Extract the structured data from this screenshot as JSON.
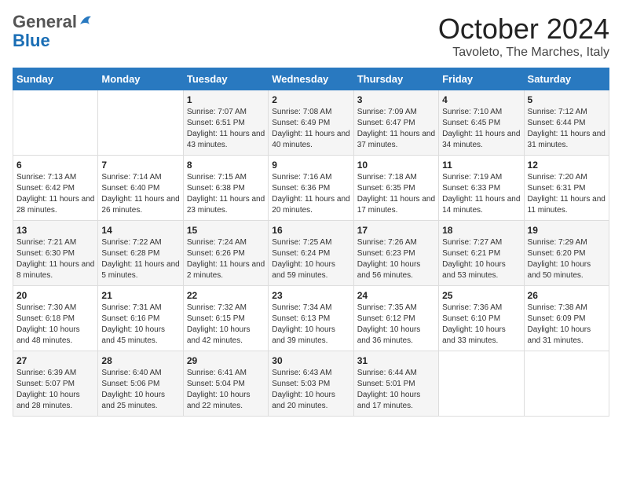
{
  "header": {
    "logo_general": "General",
    "logo_blue": "Blue",
    "month": "October 2024",
    "location": "Tavoleto, The Marches, Italy"
  },
  "days_of_week": [
    "Sunday",
    "Monday",
    "Tuesday",
    "Wednesday",
    "Thursday",
    "Friday",
    "Saturday"
  ],
  "weeks": [
    [
      {
        "day": null
      },
      {
        "day": null
      },
      {
        "day": "1",
        "sunrise": "Sunrise: 7:07 AM",
        "sunset": "Sunset: 6:51 PM",
        "daylight": "Daylight: 11 hours and 43 minutes."
      },
      {
        "day": "2",
        "sunrise": "Sunrise: 7:08 AM",
        "sunset": "Sunset: 6:49 PM",
        "daylight": "Daylight: 11 hours and 40 minutes."
      },
      {
        "day": "3",
        "sunrise": "Sunrise: 7:09 AM",
        "sunset": "Sunset: 6:47 PM",
        "daylight": "Daylight: 11 hours and 37 minutes."
      },
      {
        "day": "4",
        "sunrise": "Sunrise: 7:10 AM",
        "sunset": "Sunset: 6:45 PM",
        "daylight": "Daylight: 11 hours and 34 minutes."
      },
      {
        "day": "5",
        "sunrise": "Sunrise: 7:12 AM",
        "sunset": "Sunset: 6:44 PM",
        "daylight": "Daylight: 11 hours and 31 minutes."
      }
    ],
    [
      {
        "day": "6",
        "sunrise": "Sunrise: 7:13 AM",
        "sunset": "Sunset: 6:42 PM",
        "daylight": "Daylight: 11 hours and 28 minutes."
      },
      {
        "day": "7",
        "sunrise": "Sunrise: 7:14 AM",
        "sunset": "Sunset: 6:40 PM",
        "daylight": "Daylight: 11 hours and 26 minutes."
      },
      {
        "day": "8",
        "sunrise": "Sunrise: 7:15 AM",
        "sunset": "Sunset: 6:38 PM",
        "daylight": "Daylight: 11 hours and 23 minutes."
      },
      {
        "day": "9",
        "sunrise": "Sunrise: 7:16 AM",
        "sunset": "Sunset: 6:36 PM",
        "daylight": "Daylight: 11 hours and 20 minutes."
      },
      {
        "day": "10",
        "sunrise": "Sunrise: 7:18 AM",
        "sunset": "Sunset: 6:35 PM",
        "daylight": "Daylight: 11 hours and 17 minutes."
      },
      {
        "day": "11",
        "sunrise": "Sunrise: 7:19 AM",
        "sunset": "Sunset: 6:33 PM",
        "daylight": "Daylight: 11 hours and 14 minutes."
      },
      {
        "day": "12",
        "sunrise": "Sunrise: 7:20 AM",
        "sunset": "Sunset: 6:31 PM",
        "daylight": "Daylight: 11 hours and 11 minutes."
      }
    ],
    [
      {
        "day": "13",
        "sunrise": "Sunrise: 7:21 AM",
        "sunset": "Sunset: 6:30 PM",
        "daylight": "Daylight: 11 hours and 8 minutes."
      },
      {
        "day": "14",
        "sunrise": "Sunrise: 7:22 AM",
        "sunset": "Sunset: 6:28 PM",
        "daylight": "Daylight: 11 hours and 5 minutes."
      },
      {
        "day": "15",
        "sunrise": "Sunrise: 7:24 AM",
        "sunset": "Sunset: 6:26 PM",
        "daylight": "Daylight: 11 hours and 2 minutes."
      },
      {
        "day": "16",
        "sunrise": "Sunrise: 7:25 AM",
        "sunset": "Sunset: 6:24 PM",
        "daylight": "Daylight: 10 hours and 59 minutes."
      },
      {
        "day": "17",
        "sunrise": "Sunrise: 7:26 AM",
        "sunset": "Sunset: 6:23 PM",
        "daylight": "Daylight: 10 hours and 56 minutes."
      },
      {
        "day": "18",
        "sunrise": "Sunrise: 7:27 AM",
        "sunset": "Sunset: 6:21 PM",
        "daylight": "Daylight: 10 hours and 53 minutes."
      },
      {
        "day": "19",
        "sunrise": "Sunrise: 7:29 AM",
        "sunset": "Sunset: 6:20 PM",
        "daylight": "Daylight: 10 hours and 50 minutes."
      }
    ],
    [
      {
        "day": "20",
        "sunrise": "Sunrise: 7:30 AM",
        "sunset": "Sunset: 6:18 PM",
        "daylight": "Daylight: 10 hours and 48 minutes."
      },
      {
        "day": "21",
        "sunrise": "Sunrise: 7:31 AM",
        "sunset": "Sunset: 6:16 PM",
        "daylight": "Daylight: 10 hours and 45 minutes."
      },
      {
        "day": "22",
        "sunrise": "Sunrise: 7:32 AM",
        "sunset": "Sunset: 6:15 PM",
        "daylight": "Daylight: 10 hours and 42 minutes."
      },
      {
        "day": "23",
        "sunrise": "Sunrise: 7:34 AM",
        "sunset": "Sunset: 6:13 PM",
        "daylight": "Daylight: 10 hours and 39 minutes."
      },
      {
        "day": "24",
        "sunrise": "Sunrise: 7:35 AM",
        "sunset": "Sunset: 6:12 PM",
        "daylight": "Daylight: 10 hours and 36 minutes."
      },
      {
        "day": "25",
        "sunrise": "Sunrise: 7:36 AM",
        "sunset": "Sunset: 6:10 PM",
        "daylight": "Daylight: 10 hours and 33 minutes."
      },
      {
        "day": "26",
        "sunrise": "Sunrise: 7:38 AM",
        "sunset": "Sunset: 6:09 PM",
        "daylight": "Daylight: 10 hours and 31 minutes."
      }
    ],
    [
      {
        "day": "27",
        "sunrise": "Sunrise: 6:39 AM",
        "sunset": "Sunset: 5:07 PM",
        "daylight": "Daylight: 10 hours and 28 minutes."
      },
      {
        "day": "28",
        "sunrise": "Sunrise: 6:40 AM",
        "sunset": "Sunset: 5:06 PM",
        "daylight": "Daylight: 10 hours and 25 minutes."
      },
      {
        "day": "29",
        "sunrise": "Sunrise: 6:41 AM",
        "sunset": "Sunset: 5:04 PM",
        "daylight": "Daylight: 10 hours and 22 minutes."
      },
      {
        "day": "30",
        "sunrise": "Sunrise: 6:43 AM",
        "sunset": "Sunset: 5:03 PM",
        "daylight": "Daylight: 10 hours and 20 minutes."
      },
      {
        "day": "31",
        "sunrise": "Sunrise: 6:44 AM",
        "sunset": "Sunset: 5:01 PM",
        "daylight": "Daylight: 10 hours and 17 minutes."
      },
      {
        "day": null
      },
      {
        "day": null
      }
    ]
  ]
}
